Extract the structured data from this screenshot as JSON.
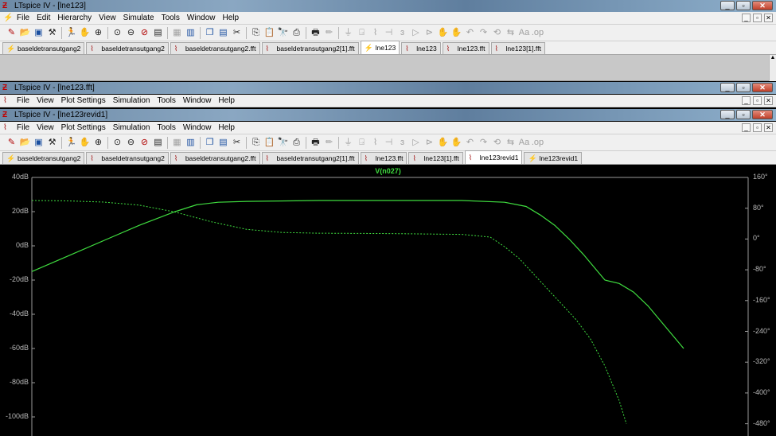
{
  "windows": [
    {
      "title": "LTspice IV - [lne123]"
    },
    {
      "title": "LTspice IV - [lne123.fft]"
    },
    {
      "title": "LTspice IV - [lne123revid1]"
    }
  ],
  "menus": {
    "schematic": [
      "File",
      "Edit",
      "Hierarchy",
      "View",
      "Simulate",
      "Tools",
      "Window",
      "Help"
    ],
    "waveform": [
      "File",
      "View",
      "Plot Settings",
      "Simulation",
      "Tools",
      "Window",
      "Help"
    ]
  },
  "tabs_top": [
    {
      "label": "baseldetransutgang2",
      "kind": "schematic"
    },
    {
      "label": "baseldetransutgang2",
      "kind": "waveform"
    },
    {
      "label": "baseldetransutgang2.fft",
      "kind": "waveform"
    },
    {
      "label": "baseldetransutgang2[1].fft",
      "kind": "waveform"
    },
    {
      "label": "lne123",
      "kind": "schematic",
      "active": true
    },
    {
      "label": "lne123",
      "kind": "waveform"
    },
    {
      "label": "lne123.fft",
      "kind": "waveform"
    },
    {
      "label": "lne123[1].fft",
      "kind": "waveform"
    }
  ],
  "tabs_bottom": [
    {
      "label": "baseldetransutgang2",
      "kind": "schematic"
    },
    {
      "label": "baseldetransutgang2",
      "kind": "waveform"
    },
    {
      "label": "baseldetransutgang2.fft",
      "kind": "waveform"
    },
    {
      "label": "baseldetransutgang2[1].fft",
      "kind": "waveform"
    },
    {
      "label": "lne123.fft",
      "kind": "waveform"
    },
    {
      "label": "lne123[1].fft",
      "kind": "waveform"
    },
    {
      "label": "lne123revid1",
      "kind": "waveform",
      "active": true
    },
    {
      "label": "lne123revid1",
      "kind": "schematic"
    }
  ],
  "toolbar_icons": [
    "new-schematic-icon",
    "open-icon",
    "save-icon",
    "control-panel-icon",
    "run-icon",
    "halt-icon",
    "zoom-in-icon",
    "zoom-pan-icon",
    "zoom-out-icon",
    "zoom-fit-icon",
    "autorange-icon",
    "grid-icon",
    "tile-vertical-icon",
    "cascade-icon",
    "tile-horizontal-icon",
    "cut-icon",
    "copy-icon",
    "paste-icon",
    "find-icon",
    "print-setup-icon",
    "print-icon",
    "wire-icon",
    "ground-icon",
    "label-net-icon",
    "resistor-icon",
    "capacitor-icon",
    "inductor-icon",
    "diode-icon",
    "component-icon",
    "move-icon",
    "drag-icon",
    "undo-icon",
    "redo-icon",
    "rotate-icon",
    "mirror-icon",
    "text-icon",
    "spice-directive-icon"
  ],
  "chart_data": {
    "type": "line",
    "title": "V(n027)",
    "y_left": {
      "ticks": [
        "40dB",
        "20dB",
        "0dB",
        "-20dB",
        "-40dB",
        "-60dB",
        "-80dB",
        "-100dB"
      ],
      "range": [
        -100,
        40
      ],
      "unit": "dB"
    },
    "y_right": {
      "ticks": [
        "160°",
        "80°",
        "0°",
        "-80°",
        "-160°",
        "-240°",
        "-320°",
        "-400°",
        "-480°"
      ],
      "range": [
        -480,
        160
      ],
      "unit": "°"
    },
    "series": [
      {
        "style": "solid",
        "color": "#3fdc3f",
        "points": [
          [
            0,
            -15
          ],
          [
            0.05,
            -6
          ],
          [
            0.1,
            3
          ],
          [
            0.15,
            12
          ],
          [
            0.2,
            20
          ],
          [
            0.23,
            24
          ],
          [
            0.26,
            25.5
          ],
          [
            0.3,
            26
          ],
          [
            0.4,
            26.5
          ],
          [
            0.5,
            26.5
          ],
          [
            0.6,
            26.5
          ],
          [
            0.66,
            25.5
          ],
          [
            0.69,
            23
          ],
          [
            0.71,
            18
          ],
          [
            0.73,
            12
          ],
          [
            0.75,
            4
          ],
          [
            0.77,
            -5
          ],
          [
            0.79,
            -15
          ],
          [
            0.8,
            -20
          ],
          [
            0.82,
            -22
          ],
          [
            0.84,
            -27
          ],
          [
            0.86,
            -35
          ],
          [
            0.88,
            -45
          ],
          [
            0.9,
            -55
          ],
          [
            0.91,
            -60
          ]
        ]
      },
      {
        "style": "dotted",
        "color": "#3fdc3f",
        "points": [
          [
            0,
            100
          ],
          [
            0.05,
            99
          ],
          [
            0.1,
            96
          ],
          [
            0.15,
            88
          ],
          [
            0.2,
            70
          ],
          [
            0.25,
            45
          ],
          [
            0.3,
            25
          ],
          [
            0.35,
            17
          ],
          [
            0.4,
            15
          ],
          [
            0.5,
            14
          ],
          [
            0.6,
            12
          ],
          [
            0.64,
            5
          ],
          [
            0.66,
            -20
          ],
          [
            0.68,
            -50
          ],
          [
            0.7,
            -90
          ],
          [
            0.72,
            -130
          ],
          [
            0.74,
            -170
          ],
          [
            0.76,
            -210
          ],
          [
            0.78,
            -260
          ],
          [
            0.8,
            -330
          ],
          [
            0.82,
            -420
          ],
          [
            0.83,
            -480
          ]
        ]
      }
    ]
  }
}
